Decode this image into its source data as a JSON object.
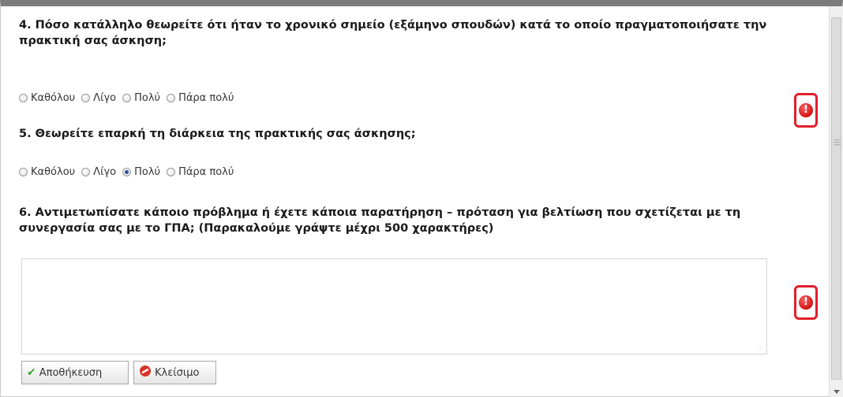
{
  "questions": {
    "q4": {
      "title": "4. Πόσο κατάλληλο θεωρείτε ότι ήταν το χρονικό σημείο (εξάμηνο σπουδών) κατά το οποίο πραγματοποιήσατε την πρακτική σας άσκηση;",
      "options": [
        "Καθόλου",
        "Λίγο",
        "Πολύ",
        "Πάρα πολύ"
      ],
      "selected": null
    },
    "q5": {
      "title": "5. Θεωρείτε επαρκή τη διάρκεια της πρακτικής σας άσκησης;",
      "options": [
        "Καθόλου",
        "Λίγο",
        "Πολύ",
        "Πάρα πολύ"
      ],
      "selected": "Πολύ"
    },
    "q6": {
      "title": "6. Αντιμετωπίσατε κάποιο πρόβλημα ή έχετε κάποια παρατήρηση – πρόταση για βελτίωση που σχετίζεται με τη συνεργασία σας με το ΓΠΑ; (Παρακαλούμε γράψτε μέχρι 500 χαρακτήρες)",
      "value": ""
    }
  },
  "buttons": {
    "save": "Αποθήκευση",
    "close": "Κλείσιμο"
  },
  "icons": {
    "error": "!",
    "save_icon": "checkmark-icon",
    "close_icon": "no-entry-icon"
  },
  "colors": {
    "error_red": "#e0202a",
    "selected_radio": "#2a4f9a",
    "save_check": "#3aa335",
    "close_icon": "#d9342b"
  }
}
